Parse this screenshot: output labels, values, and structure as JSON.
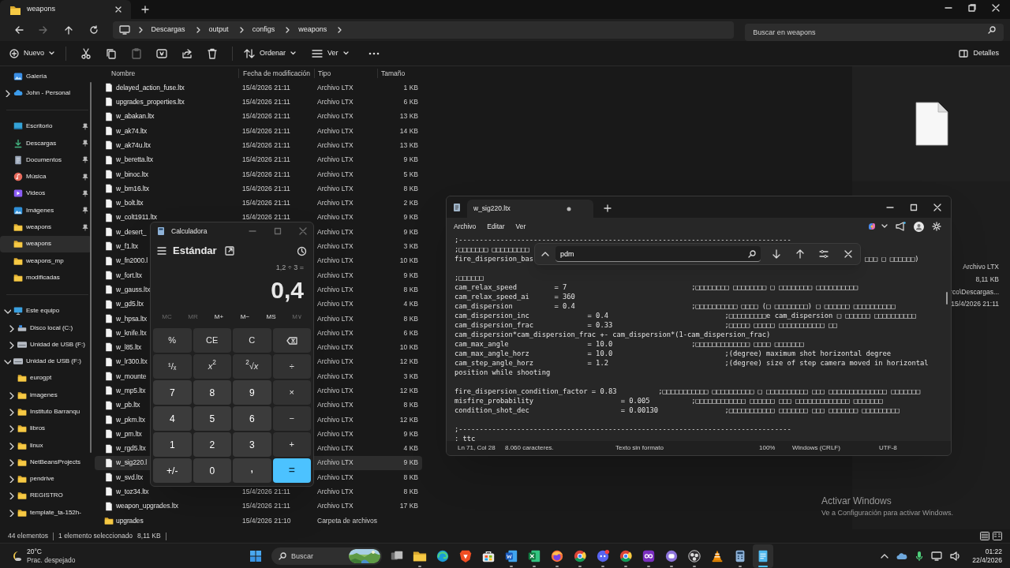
{
  "explorer": {
    "tab": {
      "title": "weapons"
    },
    "nav": [
      {
        "kind": "back",
        "disabled": false
      },
      {
        "kind": "forward",
        "disabled": true
      },
      {
        "kind": "up",
        "disabled": false
      },
      {
        "kind": "refresh",
        "disabled": false
      }
    ],
    "breadcrumbs": [
      "Descargas",
      "output",
      "configs",
      "weapons"
    ],
    "search": {
      "placeholder": "Buscar en weapons"
    },
    "toolbar": {
      "new": "Nuevo",
      "actions": [
        {
          "kind": "cut",
          "disabled": false
        },
        {
          "kind": "copy",
          "disabled": false
        },
        {
          "kind": "paste",
          "disabled": true
        },
        {
          "kind": "rename",
          "disabled": false
        },
        {
          "kind": "share",
          "disabled": false
        },
        {
          "kind": "delete",
          "disabled": false
        }
      ],
      "sort": "Ordenar",
      "view": "Ver",
      "details": "Detalles"
    },
    "sidebar": {
      "sections": [
        {
          "items": [
            {
              "label": "Galería",
              "kind": "gallery",
              "pinned": false,
              "selected": false
            },
            {
              "label": "John - Personal",
              "kind": "cloud",
              "expanded": false,
              "pinned": false,
              "selected": false
            }
          ]
        },
        {
          "items": [
            {
              "label": "Escritorio",
              "kind": "desktop",
              "pinned": true,
              "selected": false
            },
            {
              "label": "Descargas",
              "kind": "download",
              "pinned": true,
              "selected": false
            },
            {
              "label": "Documentos",
              "kind": "documents",
              "pinned": true,
              "selected": false
            },
            {
              "label": "Música",
              "kind": "music",
              "pinned": true,
              "selected": false
            },
            {
              "label": "Videos",
              "kind": "videos",
              "pinned": true,
              "selected": false
            },
            {
              "label": "Imágenes",
              "kind": "pictures",
              "pinned": true,
              "selected": false
            },
            {
              "label": "weapons",
              "kind": "folder",
              "pinned": true,
              "selected": false
            },
            {
              "label": "weapons",
              "kind": "folder",
              "pinned": false,
              "selected": true
            },
            {
              "label": "weapons_mp",
              "kind": "folder",
              "pinned": false,
              "selected": false
            },
            {
              "label": "modificadas",
              "kind": "folder",
              "pinned": false,
              "selected": false
            }
          ]
        },
        {
          "items": [
            {
              "label": "Este equipo",
              "kind": "pc",
              "expanded": true,
              "pinned": false,
              "selected": false,
              "children": [
                {
                  "label": "Disco local (C:)",
                  "kind": "disk",
                  "expanded": false,
                  "pinned": false,
                  "selected": false
                },
                {
                  "label": "Unidad de USB (F:)",
                  "kind": "usb",
                  "expanded": false,
                  "pinned": false,
                  "selected": false
                }
              ]
            },
            {
              "label": "Unidad de USB (F:)",
              "kind": "usb",
              "expanded": true,
              "pinned": false,
              "selected": false,
              "children": [
                {
                  "label": "eurogpt",
                  "kind": "folder",
                  "pinned": false,
                  "selected": false
                },
                {
                  "label": "imagenes",
                  "kind": "folder",
                  "expanded": false,
                  "pinned": false,
                  "selected": false
                },
                {
                  "label": "Instituto Barranqu",
                  "kind": "folder",
                  "expanded": false,
                  "pinned": false,
                  "selected": false
                },
                {
                  "label": "libros",
                  "kind": "folder",
                  "expanded": false,
                  "pinned": false,
                  "selected": false
                },
                {
                  "label": "linux",
                  "kind": "folder",
                  "expanded": false,
                  "pinned": false,
                  "selected": false
                },
                {
                  "label": "NetBeansProjects",
                  "kind": "folder",
                  "expanded": false,
                  "pinned": false,
                  "selected": false
                },
                {
                  "label": "pendrive",
                  "kind": "folder",
                  "expanded": false,
                  "pinned": false,
                  "selected": false
                },
                {
                  "label": "REGISTRO",
                  "kind": "folder",
                  "expanded": false,
                  "pinned": false,
                  "selected": false
                },
                {
                  "label": "template_ta-152h-",
                  "kind": "folder",
                  "expanded": false,
                  "pinned": false,
                  "selected": false
                }
              ]
            }
          ]
        }
      ]
    },
    "columns": [
      "Nombre",
      "Fecha de modificación",
      "Tipo",
      "Tamaño"
    ],
    "rows": [
      {
        "kind": "file",
        "name": "delayed_action_fuse.ltx",
        "date": "15/4/2026 21:11",
        "type": "Archivo LTX",
        "size": "1 KB",
        "selected": false
      },
      {
        "kind": "file",
        "name": "upgrades_properties.ltx",
        "date": "15/4/2026 21:11",
        "type": "Archivo LTX",
        "size": "6 KB",
        "selected": false
      },
      {
        "kind": "file",
        "name": "w_abakan.ltx",
        "date": "15/4/2026 21:11",
        "type": "Archivo LTX",
        "size": "13 KB",
        "selected": false
      },
      {
        "kind": "file",
        "name": "w_ak74.ltx",
        "date": "15/4/2026 21:11",
        "type": "Archivo LTX",
        "size": "14 KB",
        "selected": false
      },
      {
        "kind": "file",
        "name": "w_ak74u.ltx",
        "date": "15/4/2026 21:11",
        "type": "Archivo LTX",
        "size": "13 KB",
        "selected": false
      },
      {
        "kind": "file",
        "name": "w_beretta.ltx",
        "date": "15/4/2026 21:11",
        "type": "Archivo LTX",
        "size": "9 KB",
        "selected": false
      },
      {
        "kind": "file",
        "name": "w_binoc.ltx",
        "date": "15/4/2026 21:11",
        "type": "Archivo LTX",
        "size": "5 KB",
        "selected": false
      },
      {
        "kind": "file",
        "name": "w_bm16.ltx",
        "date": "15/4/2026 21:11",
        "type": "Archivo LTX",
        "size": "8 KB",
        "selected": false
      },
      {
        "kind": "file",
        "name": "w_bolt.ltx",
        "date": "15/4/2026 21:11",
        "type": "Archivo LTX",
        "size": "2 KB",
        "selected": false
      },
      {
        "kind": "file",
        "name": "w_colt1911.ltx",
        "date": "15/4/2026 21:11",
        "type": "Archivo LTX",
        "size": "9 KB",
        "selected": false
      },
      {
        "kind": "file",
        "name": "w_desert_",
        "type": "Archivo LTX",
        "size": "9 KB",
        "selected": false
      },
      {
        "kind": "file",
        "name": "w_f1.ltx",
        "type": "Archivo LTX",
        "size": "3 KB",
        "selected": false
      },
      {
        "kind": "file",
        "name": "w_fn2000.l",
        "type": "Archivo LTX",
        "size": "10 KB",
        "selected": false
      },
      {
        "kind": "file",
        "name": "w_fort.ltx",
        "type": "Archivo LTX",
        "size": "9 KB",
        "selected": false
      },
      {
        "kind": "file",
        "name": "w_gauss.ltx",
        "type": "Archivo LTX",
        "size": "8 KB",
        "selected": false
      },
      {
        "kind": "file",
        "name": "w_gd5.ltx",
        "type": "Archivo LTX",
        "size": "4 KB",
        "selected": false
      },
      {
        "kind": "file",
        "name": "w_hpsa.ltx",
        "type": "Archivo LTX",
        "size": "8 KB",
        "selected": false
      },
      {
        "kind": "file",
        "name": "w_knife.ltx",
        "type": "Archivo LTX",
        "size": "6 KB",
        "selected": false
      },
      {
        "kind": "file",
        "name": "w_l85.ltx",
        "type": "Archivo LTX",
        "size": "10 KB",
        "selected": false
      },
      {
        "kind": "file",
        "name": "w_lr300.ltx",
        "type": "Archivo LTX",
        "size": "12 KB",
        "selected": false
      },
      {
        "kind": "file",
        "name": "w_mounte",
        "type": "Archivo LTX",
        "size": "3 KB",
        "selected": false
      },
      {
        "kind": "file",
        "name": "w_mp5.ltx",
        "type": "Archivo LTX",
        "size": "12 KB",
        "selected": false
      },
      {
        "kind": "file",
        "name": "w_pb.ltx",
        "type": "Archivo LTX",
        "size": "8 KB",
        "selected": false
      },
      {
        "kind": "file",
        "name": "w_pkm.ltx",
        "type": "Archivo LTX",
        "size": "12 KB",
        "selected": false
      },
      {
        "kind": "file",
        "name": "w_pm.ltx",
        "type": "Archivo LTX",
        "size": "9 KB",
        "selected": false
      },
      {
        "kind": "file",
        "name": "w_rgd5.ltx",
        "type": "Archivo LTX",
        "size": "4 KB",
        "selected": false
      },
      {
        "kind": "file",
        "name": "w_sig220.l",
        "type": "Archivo LTX",
        "size": "9 KB",
        "selected": true
      },
      {
        "kind": "file",
        "name": "w_svd.ltx",
        "type": "Archivo LTX",
        "size": "8 KB",
        "selected": false
      },
      {
        "kind": "file",
        "name": "w_toz34.ltx",
        "date": "15/4/2026 21:11",
        "type": "Archivo LTX",
        "size": "8 KB",
        "selected": false
      },
      {
        "kind": "file",
        "name": "weapon_upgrades.ltx",
        "date": "15/4/2026 21:11",
        "type": "Archivo LTX",
        "size": "17 KB",
        "selected": false
      },
      {
        "kind": "folder",
        "name": "upgrades",
        "date": "15/4/2026 21:10",
        "type": "Carpeta de archivos",
        "selected": false
      }
    ],
    "details": {
      "type": "Archivo LTX",
      "size": "8,11 KB",
      "path": "rco\\Descargas...",
      "date": "15/4/2026 21:11"
    },
    "status_bar": {
      "count": "44 elementos",
      "selection": "1 elemento seleccionado",
      "size": "8,11 KB"
    }
  },
  "calculator": {
    "title": "Calculadora",
    "mode": "Estándar",
    "expression": "1,2 ÷ 3 =",
    "result": "0,4",
    "memory": [
      {
        "label": "MC",
        "disabled": true
      },
      {
        "label": "MR",
        "disabled": true
      },
      {
        "label": "M+",
        "disabled": false
      },
      {
        "label": "M−",
        "disabled": false
      },
      {
        "label": "MS",
        "disabled": false
      },
      {
        "label": "M∨",
        "disabled": true
      }
    ],
    "keys": [
      {
        "kind": "op",
        "label": "%"
      },
      {
        "kind": "op",
        "label": "CE"
      },
      {
        "kind": "op",
        "label": "C"
      },
      {
        "kind": "backspace"
      },
      {
        "kind": "op",
        "label": "¹/ₓ"
      },
      {
        "kind": "op",
        "label": "*x*$^{2}$"
      },
      {
        "kind": "op",
        "label": "$^{2}$√*x*"
      },
      {
        "kind": "op",
        "label": "÷"
      },
      {
        "kind": "digit",
        "label": "7"
      },
      {
        "kind": "digit",
        "label": "8"
      },
      {
        "kind": "digit",
        "label": "9"
      },
      {
        "kind": "op",
        "label": "×"
      },
      {
        "kind": "digit",
        "label": "4"
      },
      {
        "kind": "digit",
        "label": "5"
      },
      {
        "kind": "digit",
        "label": "6"
      },
      {
        "kind": "op",
        "label": "−"
      },
      {
        "kind": "digit",
        "label": "1"
      },
      {
        "kind": "digit",
        "label": "2"
      },
      {
        "kind": "digit",
        "label": "3"
      },
      {
        "kind": "op",
        "label": "+"
      },
      {
        "kind": "digit",
        "label": "+/-"
      },
      {
        "kind": "digit",
        "label": "0"
      },
      {
        "kind": "decimal",
        "label": ","
      },
      {
        "kind": "equals",
        "label": "="
      }
    ]
  },
  "notepad": {
    "tab": {
      "title": "w_sig220.ltx",
      "unsaved": true
    },
    "menu": [
      "Archivo",
      "Editar",
      "Ver"
    ],
    "find": {
      "query": "pdm"
    },
    "lines": [
      {
        "kind": "text",
        "text": ";--------------------------------------------------------------------------------"
      },
      {
        "kind": "text",
        "text": ";□□□□□□□ □□□□□□□□□"
      },
      {
        "kind": "text",
        "text": "fire_dispersion_bas",
        "tail": "□□□ □ □□□□□□)"
      },
      {
        "kind": "blank"
      },
      {
        "kind": "text",
        "text": ";□□□□□□"
      },
      {
        "kind": "text",
        "text": "cam_relax_speed         = 7                              ;□□□□□□□□ □□□□□□□□ □ □□□□□□□□ □□□□□□□□□□"
      },
      {
        "kind": "text",
        "text": "cam_relax_speed_ai      = 360"
      },
      {
        "kind": "text",
        "text": "cam_dispersion          = 0.4                            ;□□□□□□□□□□ □□□□ (□ □□□□□□□□) □ □□□□□□ □□□□□□□□□□"
      },
      {
        "kind": "text",
        "text": "cam_dispersion_inc              = 0.4                            ;□□□□□□□□□e cam_dispersion □ □□□□□□ □□□□□□□□□□"
      },
      {
        "kind": "text",
        "text": "cam_dispersion_frac             = 0.33                           ;□□□□□ □□□□□ □□□□□□□□□□□ □□"
      },
      {
        "kind": "text",
        "text": "cam_dispersion*cam_dispersion_frac +- cam_dispersion*(1-cam_dispersion_frac)"
      },
      {
        "kind": "text",
        "text": "cam_max_angle                   = 10.0                   ;□□□□□□□□□□□□□ □□□□ □□□□□□□"
      },
      {
        "kind": "text",
        "text": "cam_max_angle_horz              = 10.0                           ;(degree) maximum shot horizontal degree"
      },
      {
        "kind": "text",
        "text": "cam_step_angle_horz             = 1.2                            ;(degree) size of step camera moved in horizontal"
      },
      {
        "kind": "text",
        "text": "position while shooting"
      },
      {
        "kind": "blank"
      },
      {
        "kind": "text",
        "text": "fire_dispersion_condition_factor = 0.83          ;□□□□□□□□□□□ □□□□□□□□□□ □ □□□□□□□□□□ □□□ □□□□□□□□□□□□□□ □□□□□□□"
      },
      {
        "kind": "text",
        "text": "misfire_probability                     = 0.005          ;□□□□□□□□□□□□ □□□□□□ □□□ □□□□□□□□□□□□□ □□□□□□□"
      },
      {
        "kind": "text",
        "text": "condition_shot_dec                      = 0.00130                ;□□□□□□□□□□□ □□□□□□□ □□□ □□□□□□□ □□□□□□□□□"
      },
      {
        "kind": "blank"
      },
      {
        "kind": "text",
        "text": ";--------------------------------------------------------------------------------"
      },
      {
        "kind": "text",
        "text": ": ttc"
      }
    ],
    "status_bar": [
      "Ln 71, Col 28",
      "8.060 caracteres.",
      "Texto sin formato",
      "100%",
      "Windows (CRLF)",
      "UTF-8"
    ]
  },
  "activation": {
    "title": "Activar Windows",
    "message": "Ve a Configuración para activar Windows."
  },
  "taskbar": {
    "weather": {
      "temp": "20°C",
      "condition": "Prac. despejado"
    },
    "search": {
      "placeholder": "Buscar"
    },
    "apps": [
      {
        "kind": "taskview",
        "running": false,
        "active": false
      },
      {
        "kind": "explorer",
        "running": true,
        "active": false
      },
      {
        "kind": "edge",
        "running": false,
        "active": false
      },
      {
        "kind": "brave",
        "running": false,
        "active": false
      },
      {
        "kind": "store",
        "running": false,
        "active": false
      },
      {
        "kind": "word",
        "running": true,
        "active": false
      },
      {
        "kind": "excel",
        "running": true,
        "active": false
      },
      {
        "kind": "firefox",
        "running": true,
        "active": false
      },
      {
        "kind": "chrome",
        "running": true,
        "active": false
      },
      {
        "kind": "discord",
        "running": true,
        "active": false
      },
      {
        "kind": "chrome",
        "running": true,
        "active": false
      },
      {
        "kind": "purple",
        "running": true,
        "active": false
      },
      {
        "kind": "violet",
        "running": true,
        "active": false
      },
      {
        "kind": "obs",
        "running": true,
        "active": false
      },
      {
        "kind": "vlc",
        "running": false,
        "active": false
      },
      {
        "kind": "calculator",
        "running": true,
        "active": false
      },
      {
        "kind": "notepad",
        "running": true,
        "active": true
      }
    ],
    "clock": {
      "time": "01:22",
      "date": "22/4/2026"
    }
  }
}
